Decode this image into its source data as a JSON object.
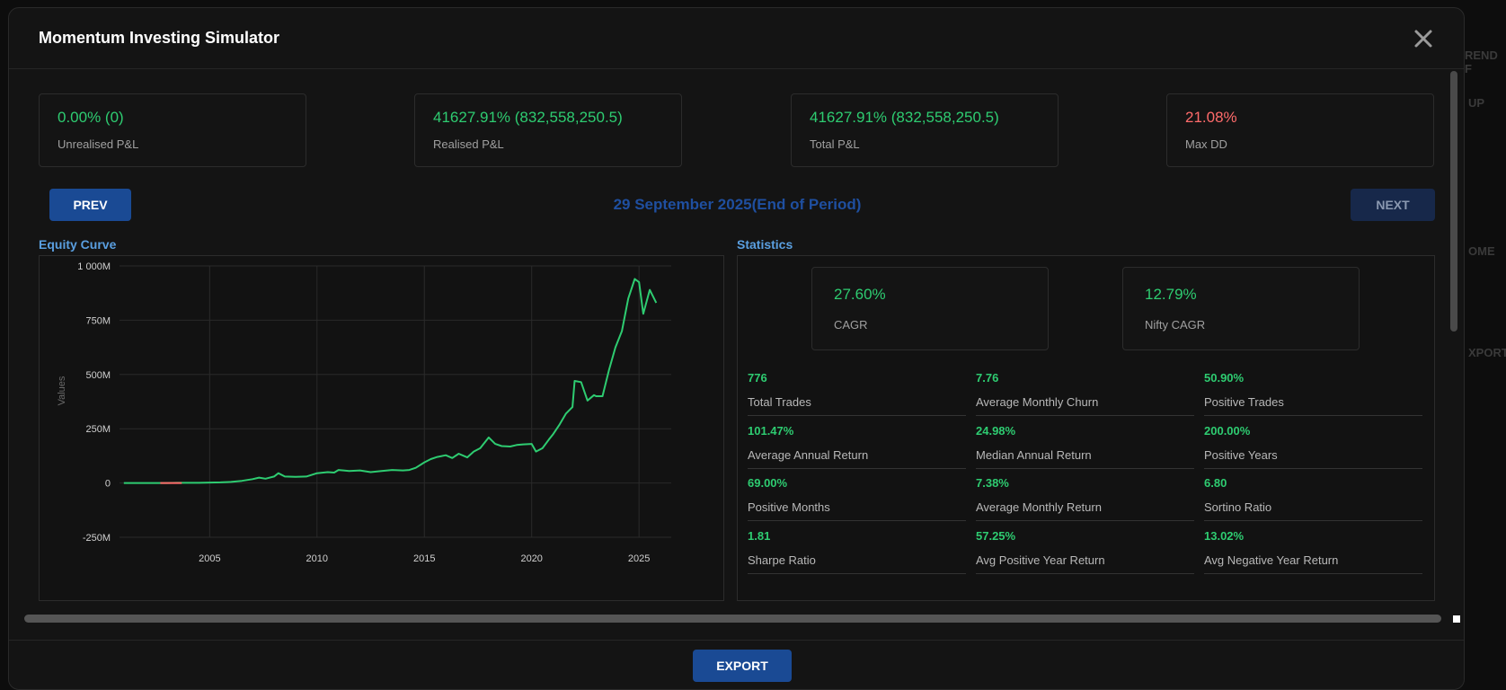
{
  "background": {
    "fragments": [
      "REND F",
      "UP",
      "OME",
      "XPORT"
    ]
  },
  "modal": {
    "title": "Momentum Investing Simulator"
  },
  "kpis": [
    {
      "value": "0.00% (0)",
      "label": "Unrealised P&L",
      "tone": "positive"
    },
    {
      "value": "41627.91% (832,558,250.5)",
      "label": "Realised P&L",
      "tone": "positive"
    },
    {
      "value": "41627.91% (832,558,250.5)",
      "label": "Total P&L",
      "tone": "positive"
    },
    {
      "value": "21.08%",
      "label": "Max DD",
      "tone": "negative"
    }
  ],
  "navigation": {
    "prev_label": "PREV",
    "next_label": "NEXT",
    "period": "29 September 2025(End of Period)"
  },
  "equity": {
    "title": "Equity Curve"
  },
  "statistics": {
    "title": "Statistics",
    "headline": [
      {
        "value": "27.60%",
        "label": "CAGR"
      },
      {
        "value": "12.79%",
        "label": "Nifty CAGR"
      }
    ],
    "items": [
      {
        "value": "776",
        "label": "Total Trades"
      },
      {
        "value": "7.76",
        "label": "Average Monthly Churn"
      },
      {
        "value": "50.90%",
        "label": "Positive Trades"
      },
      {
        "value": "101.47%",
        "label": "Average Annual Return"
      },
      {
        "value": "24.98%",
        "label": "Median Annual Return"
      },
      {
        "value": "200.00%",
        "label": "Positive Years"
      },
      {
        "value": "69.00%",
        "label": "Positive Months"
      },
      {
        "value": "7.38%",
        "label": "Average Monthly Return"
      },
      {
        "value": "6.80",
        "label": "Sortino Ratio"
      },
      {
        "value": "1.81",
        "label": "Sharpe Ratio"
      },
      {
        "value": "57.25%",
        "label": "Avg Positive Year Return"
      },
      {
        "value": "13.02%",
        "label": "Avg Negative Year Return"
      }
    ]
  },
  "footer": {
    "export_label": "EXPORT"
  },
  "colors": {
    "positive": "#2ecc71",
    "negative": "#ff6b6b",
    "accent": "#1a4a94",
    "section_title": "#5a9fe0"
  },
  "chart_data": {
    "type": "line",
    "title": "",
    "xlabel": "",
    "ylabel": "Values",
    "xlim": [
      2000.8,
      2026.5
    ],
    "ylim": [
      -250,
      1000
    ],
    "ytick_values": [
      -250,
      0,
      250,
      500,
      750,
      1000
    ],
    "ytick_labels": [
      "-250M",
      "0",
      "250M",
      "500M",
      "750M",
      "1 000M"
    ],
    "xticks": [
      2005,
      2010,
      2015,
      2020,
      2025
    ],
    "grid": true,
    "series": [
      {
        "color": "#2ecc71",
        "x": [
          2001.0,
          2001.5,
          2002.0,
          2002.5,
          2003.0,
          2003.5,
          2004.0,
          2004.5,
          2005.0,
          2005.5,
          2006.0,
          2006.5,
          2007.0,
          2007.3,
          2007.6,
          2008.0,
          2008.2,
          2008.5,
          2009.0,
          2009.5,
          2010.0,
          2010.5,
          2010.8,
          2011.0,
          2011.5,
          2012.0,
          2012.5,
          2013.0,
          2013.5,
          2014.0,
          2014.3,
          2014.6,
          2015.0,
          2015.3,
          2015.6,
          2016.0,
          2016.3,
          2016.6,
          2017.0,
          2017.3,
          2017.6,
          2018.0,
          2018.3,
          2018.6,
          2019.0,
          2019.3,
          2019.6,
          2020.0,
          2020.2,
          2020.5,
          2020.8,
          2021.0,
          2021.3,
          2021.6,
          2021.9,
          2022.0,
          2022.3,
          2022.6,
          2022.9,
          2023.0,
          2023.3,
          2023.6,
          2023.9,
          2024.2,
          2024.5,
          2024.8,
          2025.0,
          2025.2,
          2025.5,
          2025.8
        ],
        "y": [
          0,
          0,
          0,
          0,
          0,
          1,
          1,
          1,
          2,
          3,
          5,
          10,
          18,
          25,
          20,
          30,
          45,
          30,
          28,
          30,
          45,
          50,
          48,
          60,
          55,
          58,
          50,
          55,
          60,
          58,
          60,
          70,
          95,
          110,
          120,
          128,
          115,
          135,
          118,
          145,
          160,
          210,
          180,
          170,
          168,
          175,
          178,
          180,
          145,
          160,
          200,
          225,
          270,
          320,
          350,
          470,
          465,
          380,
          405,
          400,
          400,
          520,
          625,
          700,
          850,
          940,
          925,
          780,
          890,
          830
        ]
      },
      {
        "color": "#ff6b6b",
        "x": [
          2002.7,
          2003.7
        ],
        "y": [
          0,
          0
        ]
      }
    ]
  }
}
